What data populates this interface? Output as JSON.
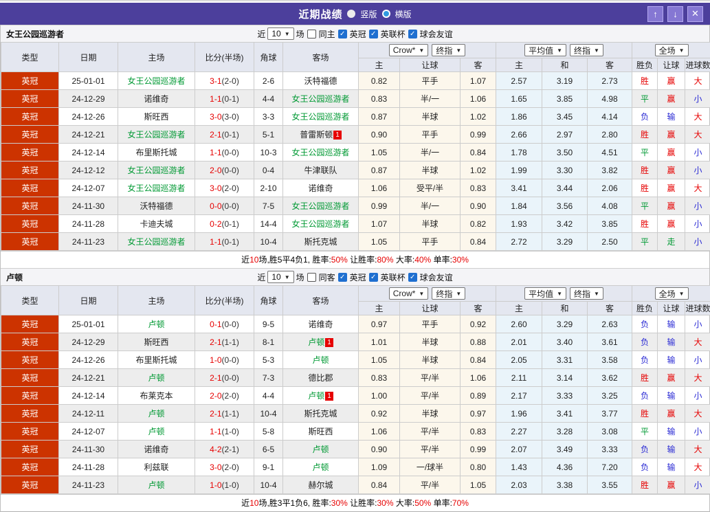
{
  "titlebar": {
    "title": "近期战绩",
    "radio_vertical": "竖版",
    "radio_horizontal": "横版",
    "selected_mode": "横版"
  },
  "head": {
    "main_cols": [
      "类型",
      "日期",
      "主场",
      "比分(半场)",
      "角球",
      "客场"
    ],
    "odds_book_select": "Crow*",
    "odds_final_select": "终指",
    "avg_select": "平均值",
    "avg_final_select": "终指",
    "scope_select": "全场",
    "odds_cols": [
      "主",
      "让球",
      "客"
    ],
    "avg_cols": [
      "主",
      "和",
      "客"
    ],
    "result_cols": [
      "胜负",
      "让球",
      "进球数"
    ]
  },
  "colors": {
    "accent_purple": "#4c3f9c",
    "type_red": "#cc3300",
    "team_green": "#009933",
    "win_red": "#e60000",
    "lose_blue": "#2a2ad4",
    "odds_bg_cream": "#fcf7ec",
    "avg_bg_blue": "#eaf4fa"
  },
  "sections": [
    {
      "team": "女王公园巡游者",
      "filters": {
        "recent_label": "近",
        "count": "10",
        "matches_label": "场",
        "same_label": "同主",
        "same_checked": false,
        "leagues": [
          {
            "label": "英冠",
            "checked": true
          },
          {
            "label": "英联杯",
            "checked": true
          },
          {
            "label": "球会友谊",
            "checked": true
          }
        ]
      },
      "rows": [
        {
          "league": "英冠",
          "date": "25-01-01",
          "home": "女王公园巡游者",
          "hf": true,
          "hb": "",
          "ft": "3-1",
          "ht": "2-0",
          "corner": "2-6",
          "away": "沃特福德",
          "af": false,
          "ab": "",
          "odds": [
            "0.82",
            "平手",
            "1.07"
          ],
          "avg": [
            "2.57",
            "3.19",
            "2.73"
          ],
          "res": [
            "胜",
            "赢",
            "大"
          ]
        },
        {
          "league": "英冠",
          "date": "24-12-29",
          "home": "诺维奇",
          "hf": false,
          "hb": "",
          "ft": "1-1",
          "ht": "0-1",
          "corner": "4-4",
          "away": "女王公园巡游者",
          "af": true,
          "ab": "",
          "odds": [
            "0.83",
            "半/一",
            "1.06"
          ],
          "avg": [
            "1.65",
            "3.85",
            "4.98"
          ],
          "res": [
            "平",
            "赢",
            "小"
          ]
        },
        {
          "league": "英冠",
          "date": "24-12-26",
          "home": "斯旺西",
          "hf": false,
          "hb": "",
          "ft": "3-0",
          "ht": "3-0",
          "corner": "3-3",
          "away": "女王公园巡游者",
          "af": true,
          "ab": "",
          "odds": [
            "0.87",
            "半球",
            "1.02"
          ],
          "avg": [
            "1.86",
            "3.45",
            "4.14"
          ],
          "res": [
            "负",
            "输",
            "大"
          ]
        },
        {
          "league": "英冠",
          "date": "24-12-21",
          "home": "女王公园巡游者",
          "hf": true,
          "hb": "",
          "ft": "2-1",
          "ht": "0-1",
          "corner": "5-1",
          "away": "普雷斯顿",
          "af": false,
          "ab": "1",
          "odds": [
            "0.90",
            "平手",
            "0.99"
          ],
          "avg": [
            "2.66",
            "2.97",
            "2.80"
          ],
          "res": [
            "胜",
            "赢",
            "大"
          ]
        },
        {
          "league": "英冠",
          "date": "24-12-14",
          "home": "布里斯托城",
          "hf": false,
          "hb": "",
          "ft": "1-1",
          "ht": "0-0",
          "corner": "10-3",
          "away": "女王公园巡游者",
          "af": true,
          "ab": "",
          "odds": [
            "1.05",
            "半/一",
            "0.84"
          ],
          "avg": [
            "1.78",
            "3.50",
            "4.51"
          ],
          "res": [
            "平",
            "赢",
            "小"
          ]
        },
        {
          "league": "英冠",
          "date": "24-12-12",
          "home": "女王公园巡游者",
          "hf": true,
          "hb": "",
          "ft": "2-0",
          "ht": "0-0",
          "corner": "0-4",
          "away": "牛津联队",
          "af": false,
          "ab": "",
          "odds": [
            "0.87",
            "半球",
            "1.02"
          ],
          "avg": [
            "1.99",
            "3.30",
            "3.82"
          ],
          "res": [
            "胜",
            "赢",
            "小"
          ]
        },
        {
          "league": "英冠",
          "date": "24-12-07",
          "home": "女王公园巡游者",
          "hf": true,
          "hb": "",
          "ft": "3-0",
          "ht": "2-0",
          "corner": "2-10",
          "away": "诺维奇",
          "af": false,
          "ab": "",
          "odds": [
            "1.06",
            "受平/半",
            "0.83"
          ],
          "avg": [
            "3.41",
            "3.44",
            "2.06"
          ],
          "res": [
            "胜",
            "赢",
            "大"
          ]
        },
        {
          "league": "英冠",
          "date": "24-11-30",
          "home": "沃特福德",
          "hf": false,
          "hb": "",
          "ft": "0-0",
          "ht": "0-0",
          "corner": "7-5",
          "away": "女王公园巡游者",
          "af": true,
          "ab": "",
          "odds": [
            "0.99",
            "半/一",
            "0.90"
          ],
          "avg": [
            "1.84",
            "3.56",
            "4.08"
          ],
          "res": [
            "平",
            "赢",
            "小"
          ]
        },
        {
          "league": "英冠",
          "date": "24-11-28",
          "home": "卡迪夫城",
          "hf": false,
          "hb": "",
          "ft": "0-2",
          "ht": "0-1",
          "corner": "14-4",
          "away": "女王公园巡游者",
          "af": true,
          "ab": "",
          "odds": [
            "1.07",
            "半球",
            "0.82"
          ],
          "avg": [
            "1.93",
            "3.42",
            "3.85"
          ],
          "res": [
            "胜",
            "赢",
            "小"
          ]
        },
        {
          "league": "英冠",
          "date": "24-11-23",
          "home": "女王公园巡游者",
          "hf": true,
          "hb": "",
          "ft": "1-1",
          "ht": "0-1",
          "corner": "10-4",
          "away": "斯托克城",
          "af": false,
          "ab": "",
          "odds": [
            "1.05",
            "平手",
            "0.84"
          ],
          "avg": [
            "2.72",
            "3.29",
            "2.50"
          ],
          "res": [
            "平",
            "走",
            "小"
          ]
        }
      ],
      "summary": [
        {
          "t": "近"
        },
        {
          "t": "10",
          "red": true
        },
        {
          "t": "场,胜5平4负1, 胜率:"
        },
        {
          "t": "50%",
          "red": true
        },
        {
          "t": " 让胜率:"
        },
        {
          "t": "80%",
          "red": true
        },
        {
          "t": " 大率:"
        },
        {
          "t": "40%",
          "red": true
        },
        {
          "t": " 单率:"
        },
        {
          "t": "30%",
          "red": true
        }
      ]
    },
    {
      "team": "卢顿",
      "filters": {
        "recent_label": "近",
        "count": "10",
        "matches_label": "场",
        "same_label": "同客",
        "same_checked": false,
        "leagues": [
          {
            "label": "英冠",
            "checked": true
          },
          {
            "label": "英联杯",
            "checked": true
          },
          {
            "label": "球会友谊",
            "checked": true
          }
        ]
      },
      "rows": [
        {
          "league": "英冠",
          "date": "25-01-01",
          "home": "卢顿",
          "hf": true,
          "hb": "",
          "ft": "0-1",
          "ht": "0-0",
          "corner": "9-5",
          "away": "诺维奇",
          "af": false,
          "ab": "",
          "odds": [
            "0.97",
            "平手",
            "0.92"
          ],
          "avg": [
            "2.60",
            "3.29",
            "2.63"
          ],
          "res": [
            "负",
            "输",
            "小"
          ]
        },
        {
          "league": "英冠",
          "date": "24-12-29",
          "home": "斯旺西",
          "hf": false,
          "hb": "",
          "ft": "2-1",
          "ht": "1-1",
          "corner": "8-1",
          "away": "卢顿",
          "af": true,
          "ab": "1",
          "odds": [
            "1.01",
            "半球",
            "0.88"
          ],
          "avg": [
            "2.01",
            "3.40",
            "3.61"
          ],
          "res": [
            "负",
            "输",
            "大"
          ]
        },
        {
          "league": "英冠",
          "date": "24-12-26",
          "home": "布里斯托城",
          "hf": false,
          "hb": "",
          "ft": "1-0",
          "ht": "0-0",
          "corner": "5-3",
          "away": "卢顿",
          "af": true,
          "ab": "",
          "odds": [
            "1.05",
            "半球",
            "0.84"
          ],
          "avg": [
            "2.05",
            "3.31",
            "3.58"
          ],
          "res": [
            "负",
            "输",
            "小"
          ]
        },
        {
          "league": "英冠",
          "date": "24-12-21",
          "home": "卢顿",
          "hf": true,
          "hb": "",
          "ft": "2-1",
          "ht": "0-0",
          "corner": "7-3",
          "away": "德比郡",
          "af": false,
          "ab": "",
          "odds": [
            "0.83",
            "平/半",
            "1.06"
          ],
          "avg": [
            "2.11",
            "3.14",
            "3.62"
          ],
          "res": [
            "胜",
            "赢",
            "大"
          ]
        },
        {
          "league": "英冠",
          "date": "24-12-14",
          "home": "布莱克本",
          "hf": false,
          "hb": "",
          "ft": "2-0",
          "ht": "2-0",
          "corner": "4-4",
          "away": "卢顿",
          "af": true,
          "ab": "1",
          "odds": [
            "1.00",
            "平/半",
            "0.89"
          ],
          "avg": [
            "2.17",
            "3.33",
            "3.25"
          ],
          "res": [
            "负",
            "输",
            "小"
          ]
        },
        {
          "league": "英冠",
          "date": "24-12-11",
          "home": "卢顿",
          "hf": true,
          "hb": "",
          "ft": "2-1",
          "ht": "1-1",
          "corner": "10-4",
          "away": "斯托克城",
          "af": false,
          "ab": "",
          "odds": [
            "0.92",
            "半球",
            "0.97"
          ],
          "avg": [
            "1.96",
            "3.41",
            "3.77"
          ],
          "res": [
            "胜",
            "赢",
            "大"
          ]
        },
        {
          "league": "英冠",
          "date": "24-12-07",
          "home": "卢顿",
          "hf": true,
          "hb": "",
          "ft": "1-1",
          "ht": "1-0",
          "corner": "5-8",
          "away": "斯旺西",
          "af": false,
          "ab": "",
          "odds": [
            "1.06",
            "平/半",
            "0.83"
          ],
          "avg": [
            "2.27",
            "3.28",
            "3.08"
          ],
          "res": [
            "平",
            "输",
            "小"
          ]
        },
        {
          "league": "英冠",
          "date": "24-11-30",
          "home": "诺维奇",
          "hf": false,
          "hb": "",
          "ft": "4-2",
          "ht": "2-1",
          "corner": "6-5",
          "away": "卢顿",
          "af": true,
          "ab": "",
          "odds": [
            "0.90",
            "平/半",
            "0.99"
          ],
          "avg": [
            "2.07",
            "3.49",
            "3.33"
          ],
          "res": [
            "负",
            "输",
            "大"
          ]
        },
        {
          "league": "英冠",
          "date": "24-11-28",
          "home": "利兹联",
          "hf": false,
          "hb": "",
          "ft": "3-0",
          "ht": "2-0",
          "corner": "9-1",
          "away": "卢顿",
          "af": true,
          "ab": "",
          "odds": [
            "1.09",
            "一/球半",
            "0.80"
          ],
          "avg": [
            "1.43",
            "4.36",
            "7.20"
          ],
          "res": [
            "负",
            "输",
            "大"
          ]
        },
        {
          "league": "英冠",
          "date": "24-11-23",
          "home": "卢顿",
          "hf": true,
          "hb": "",
          "ft": "1-0",
          "ht": "1-0",
          "corner": "10-4",
          "away": "赫尔城",
          "af": false,
          "ab": "",
          "odds": [
            "0.84",
            "平/半",
            "1.05"
          ],
          "avg": [
            "2.03",
            "3.38",
            "3.55"
          ],
          "res": [
            "胜",
            "赢",
            "小"
          ]
        }
      ],
      "summary": [
        {
          "t": "近"
        },
        {
          "t": "10",
          "red": true
        },
        {
          "t": "场,胜3平1负6, 胜率:"
        },
        {
          "t": "30%",
          "red": true
        },
        {
          "t": " 让胜率:"
        },
        {
          "t": "30%",
          "red": true
        },
        {
          "t": " 大率:"
        },
        {
          "t": "50%",
          "red": true
        },
        {
          "t": " 单率:"
        },
        {
          "t": "70%",
          "red": true
        }
      ]
    }
  ]
}
